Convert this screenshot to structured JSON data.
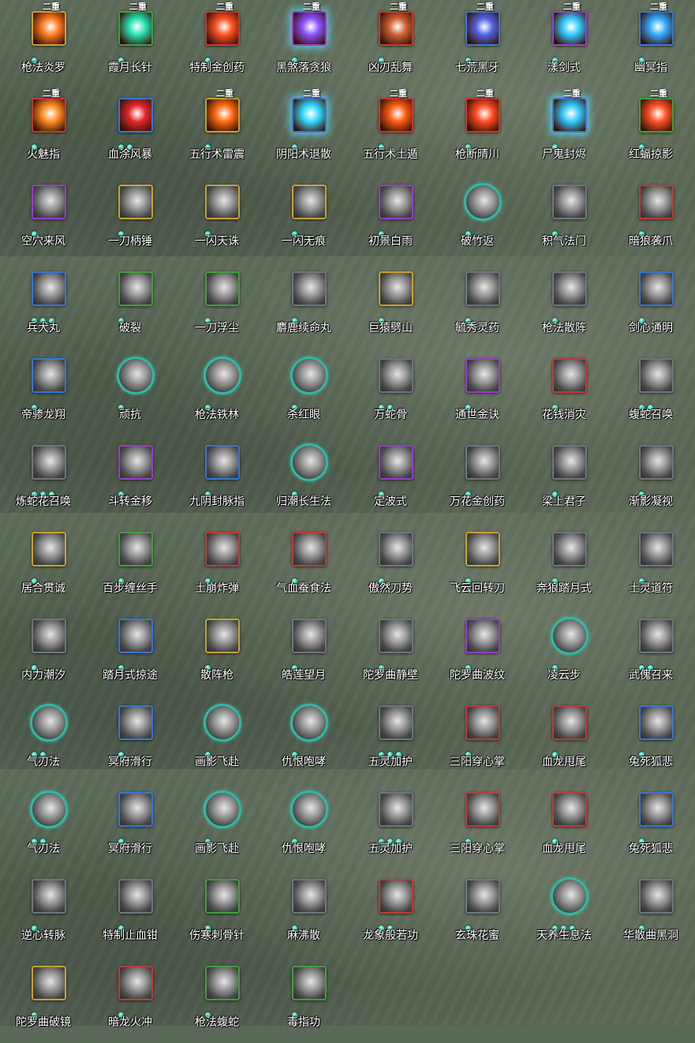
{
  "badge_text": "二重",
  "skills": [
    {
      "label": "枪法炎罗",
      "frame": "gold",
      "color": "#ff7a20",
      "badge": true,
      "dots": 1
    },
    {
      "label": "霞月长针",
      "frame": "green",
      "color": "#22e0b0",
      "badge": true,
      "dots": 1
    },
    {
      "label": "特制金创药",
      "frame": "red",
      "color": "#ff5020",
      "badge": true,
      "dots": 1
    },
    {
      "label": "黑煞落贪狼",
      "frame": "purple",
      "color": "#8a50ff",
      "badge": true,
      "dots": 1,
      "glow": true
    },
    {
      "label": "凶刃乱舞",
      "frame": "red",
      "color": "#d06030",
      "badge": true,
      "dots": 1
    },
    {
      "label": "七荒黑牙",
      "frame": "blue",
      "color": "#5060e0",
      "badge": true,
      "dots": 1
    },
    {
      "label": "漾剑式",
      "frame": "purple",
      "color": "#30c8ff",
      "badge": true,
      "dots": 1
    },
    {
      "label": "幽冥指",
      "frame": "blue",
      "color": "#30a8ff",
      "badge": true,
      "dots": 1
    },
    {
      "label": "火魅指",
      "frame": "red",
      "color": "#ff8a20",
      "badge": true,
      "dots": 1
    },
    {
      "label": "血涂风暴",
      "frame": "blue",
      "color": "#e02828",
      "badge": false,
      "dots": 2
    },
    {
      "label": "五行术雷震",
      "frame": "gold",
      "color": "#ff6a10",
      "badge": true,
      "dots": 1
    },
    {
      "label": "阴阳术退散",
      "frame": "blue",
      "color": "#30d8ff",
      "badge": true,
      "dots": 1,
      "glow": true
    },
    {
      "label": "五行术土遁",
      "frame": "red",
      "color": "#ff5a10",
      "badge": true,
      "dots": 1
    },
    {
      "label": "枪断晴川",
      "frame": "red",
      "color": "#ff4a20",
      "badge": true,
      "dots": 1
    },
    {
      "label": "尸鬼封烬",
      "frame": "blue",
      "color": "#30c8ff",
      "badge": true,
      "dots": 1,
      "glow": true
    },
    {
      "label": "红蝠掠影",
      "frame": "green",
      "color": "#ff5020",
      "badge": true,
      "dots": 1
    },
    {
      "label": "空穴来风",
      "frame": "purple",
      "dots": 1
    },
    {
      "label": "一刀柄锤",
      "frame": "gold",
      "dots": 1
    },
    {
      "label": "一闪天诛",
      "frame": "gold",
      "dots": 1
    },
    {
      "label": "一闪无痕",
      "frame": "gold",
      "dots": 1
    },
    {
      "label": "初景白雨",
      "frame": "purple",
      "dots": 1
    },
    {
      "label": "破竹返",
      "frame": "round",
      "dots": 1
    },
    {
      "label": "积气法门",
      "frame": "gray",
      "dots": 1
    },
    {
      "label": "暗狼袭爪",
      "frame": "red",
      "dots": 1
    },
    {
      "label": "兵犬丸",
      "frame": "blue",
      "dots": 3
    },
    {
      "label": "破裂",
      "frame": "green",
      "dots": 1
    },
    {
      "label": "一刀浮尘",
      "frame": "green",
      "dots": 1
    },
    {
      "label": "麝鹿续命丸",
      "frame": "gray",
      "dots": 1
    },
    {
      "label": "巨猿劈山",
      "frame": "gold",
      "dots": 1
    },
    {
      "label": "毓秀灵药",
      "frame": "gray",
      "dots": 1
    },
    {
      "label": "枪法散阵",
      "frame": "gray",
      "dots": 1
    },
    {
      "label": "剑心通明",
      "frame": "blue",
      "dots": 1
    },
    {
      "label": "帝骖龙翔",
      "frame": "blue",
      "dots": 1
    },
    {
      "label": "顽抗",
      "frame": "round",
      "dots": 1
    },
    {
      "label": "枪法铁林",
      "frame": "round",
      "dots": 1
    },
    {
      "label": "杀红眼",
      "frame": "round",
      "dots": 1
    },
    {
      "label": "万蛇骨",
      "frame": "gray",
      "dots": 2
    },
    {
      "label": "通世金诀",
      "frame": "purple",
      "dots": 1
    },
    {
      "label": "花钱消灾",
      "frame": "red",
      "dots": 1
    },
    {
      "label": "蝮蛇召唤",
      "frame": "gray",
      "dots": 2
    },
    {
      "label": "炼蛇花召唤",
      "frame": "gray",
      "dots": 3
    },
    {
      "label": "斗转金移",
      "frame": "purple",
      "dots": 1
    },
    {
      "label": "九阴封脉指",
      "frame": "blue",
      "dots": 1
    },
    {
      "label": "归潮长生法",
      "frame": "round",
      "dots": 1
    },
    {
      "label": "定波式",
      "frame": "purple",
      "dots": 1
    },
    {
      "label": "万花金创药",
      "frame": "gray",
      "dots": 1
    },
    {
      "label": "梁上君子",
      "frame": "gray",
      "dots": 1
    },
    {
      "label": "渐影凝视",
      "frame": "gray",
      "dots": 1
    },
    {
      "label": "居合贯诚",
      "frame": "gold",
      "dots": 1
    },
    {
      "label": "百步缠丝手",
      "frame": "green",
      "dots": 1
    },
    {
      "label": "土崩炸弹",
      "frame": "red",
      "dots": 1
    },
    {
      "label": "气血蚕食法",
      "frame": "red",
      "dots": 1
    },
    {
      "label": "傲然刀势",
      "frame": "gray",
      "dots": 1
    },
    {
      "label": "飞云回转刀",
      "frame": "gold",
      "dots": 1
    },
    {
      "label": "奔狼踏月式",
      "frame": "gray",
      "dots": 1
    },
    {
      "label": "土灵道符",
      "frame": "gray",
      "dots": 1
    },
    {
      "label": "内力潮汐",
      "frame": "gray",
      "dots": 1
    },
    {
      "label": "踏月式掠途",
      "frame": "blue",
      "dots": 1
    },
    {
      "label": "散阵枪",
      "frame": "gold",
      "dots": 1
    },
    {
      "label": "皓莲望月",
      "frame": "gray",
      "dots": 1
    },
    {
      "label": "陀罗曲静壁",
      "frame": "gray",
      "dots": 1
    },
    {
      "label": "陀罗曲波纹",
      "frame": "purple",
      "dots": 1
    },
    {
      "label": "凌云步",
      "frame": "round",
      "dots": 1
    },
    {
      "label": "武傀召来",
      "frame": "gray",
      "dots": 2
    },
    {
      "label": "气刃法",
      "frame": "round",
      "dots": 2
    },
    {
      "label": "冥府滑行",
      "frame": "blue",
      "dots": 1
    },
    {
      "label": "画影飞赴",
      "frame": "round",
      "dots": 1
    },
    {
      "label": "仇恨咆哮",
      "frame": "round",
      "dots": 1
    },
    {
      "label": "五灵加护",
      "frame": "gray",
      "dots": 3
    },
    {
      "label": "三阳穿心掌",
      "frame": "red",
      "dots": 1
    },
    {
      "label": "血龙甩尾",
      "frame": "red",
      "dots": 1
    },
    {
      "label": "兔死狐悲",
      "frame": "blue",
      "dots": 1
    },
    {
      "label": "气刃法",
      "frame": "round",
      "dots": 2
    },
    {
      "label": "冥府滑行",
      "frame": "blue",
      "dots": 1
    },
    {
      "label": "画影飞赴",
      "frame": "round",
      "dots": 1
    },
    {
      "label": "仇恨咆哮",
      "frame": "round",
      "dots": 1
    },
    {
      "label": "五灵加护",
      "frame": "gray",
      "dots": 3
    },
    {
      "label": "三阳穿心掌",
      "frame": "red",
      "dots": 1
    },
    {
      "label": "血龙甩尾",
      "frame": "red",
      "dots": 1
    },
    {
      "label": "兔死狐悲",
      "frame": "blue",
      "dots": 1
    },
    {
      "label": "逆心转脉",
      "frame": "gray",
      "dots": 1
    },
    {
      "label": "特制止血钳",
      "frame": "gray",
      "dots": 1
    },
    {
      "label": "伤寒刺骨针",
      "frame": "green",
      "dots": 1
    },
    {
      "label": "麻沸散",
      "frame": "gray",
      "dots": 1
    },
    {
      "label": "龙象般若功",
      "frame": "red",
      "dots": 2
    },
    {
      "label": "玄珠花蜜",
      "frame": "gray",
      "dots": 1
    },
    {
      "label": "天养生息法",
      "frame": "round",
      "dots": 3
    },
    {
      "label": "华散曲黑洞",
      "frame": "gray",
      "dots": 1
    },
    {
      "label": "陀罗曲破镜",
      "frame": "gold",
      "dots": 1
    },
    {
      "label": "暗龙火冲",
      "frame": "red",
      "dots": 1
    },
    {
      "label": "枪法蝮蛇",
      "frame": "green",
      "dots": 1
    },
    {
      "label": "毒指功",
      "frame": "green",
      "dots": 1
    }
  ]
}
